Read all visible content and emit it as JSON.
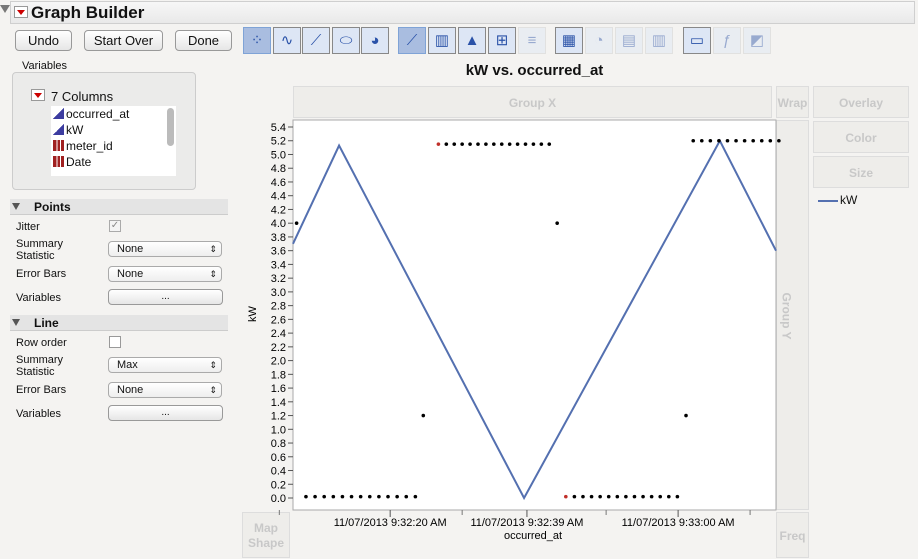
{
  "title": "Graph Builder",
  "buttons": {
    "undo": "Undo",
    "start_over": "Start Over",
    "done": "Done"
  },
  "variables": {
    "label": "Variables",
    "columns_label": "7 Columns",
    "columns": [
      {
        "name": "occurred_at",
        "type": "continuous"
      },
      {
        "name": "kW",
        "type": "continuous"
      },
      {
        "name": "meter_id",
        "type": "nominal"
      },
      {
        "name": "Date",
        "type": "nominal"
      }
    ]
  },
  "points": {
    "header": "Points",
    "jitter": "Jitter",
    "jitter_checked": true,
    "summary_label": "Summary Statistic",
    "summary_l1": "Summary",
    "summary_l2": "Statistic",
    "summary_value": "None",
    "error_bars_label": "Error Bars",
    "error_bars_value": "None",
    "variables_label": "Variables",
    "variables_button": "..."
  },
  "line": {
    "header": "Line",
    "row_order": "Row order",
    "row_order_checked": false,
    "summary_l1": "Summary",
    "summary_l2": "Statistic",
    "summary_value": "Max",
    "error_bars_label": "Error Bars",
    "error_bars_value": "None",
    "variables_label": "Variables",
    "variables_button": "..."
  },
  "zones": {
    "group_x": "Group X",
    "wrap": "Wrap",
    "overlay": "Overlay",
    "color": "Color",
    "size": "Size",
    "group_y": "Group Y",
    "map_shape_1": "Map",
    "map_shape_2": "Shape",
    "freq": "Freq"
  },
  "legend": {
    "label": "kW",
    "color": "#5470b0"
  },
  "chart_data": {
    "type": "line",
    "title": "kW vs. occurred_at",
    "xlabel": "occurred_at",
    "ylabel": "kW",
    "ylim": [
      0,
      5.4
    ],
    "yticks": [
      "0.0",
      "0.2",
      "0.4",
      "0.6",
      "0.8",
      "1.0",
      "1.2",
      "1.4",
      "1.6",
      "1.8",
      "2.0",
      "2.2",
      "2.4",
      "2.6",
      "2.8",
      "3.0",
      "3.2",
      "3.4",
      "3.6",
      "3.8",
      "4.0",
      "4.2",
      "4.4",
      "4.6",
      "4.8",
      "5.0",
      "5.2",
      "5.4"
    ],
    "x_unit": "seconds after 11/07/2013 9:32:00 AM",
    "xlim": [
      6.5,
      73.6
    ],
    "xticks": [
      {
        "value": 20,
        "label": "11/07/2013 9:32:20 AM"
      },
      {
        "value": 39,
        "label": "11/07/2013 9:32:39 AM"
      },
      {
        "value": 60,
        "label": "11/07/2013 9:33:00 AM"
      }
    ],
    "minor_xticks": [
      4.6,
      30,
      50,
      70
    ],
    "line_series": {
      "name": "kW (Max)",
      "color": "#5470b0",
      "x": [
        6.5,
        12.9,
        38.6,
        65.8,
        73.6
      ],
      "y": [
        3.7,
        5.13,
        0,
        5.2,
        3.6
      ]
    },
    "point_series": {
      "color": "#000000",
      "highlight_color": "#c0302a",
      "points": [
        {
          "x": 7,
          "y": 4.0
        },
        {
          "row_from": 8.3,
          "row_to": 23.5,
          "count": 13,
          "y": 0.02
        },
        {
          "x": 24.6,
          "y": 1.2
        },
        {
          "row_from": 26.7,
          "row_to": 42.1,
          "count": 15,
          "y": 5.15,
          "first_highlight": true
        },
        {
          "x": 43.2,
          "y": 4.0
        },
        {
          "row_from": 44.4,
          "row_to": 59.9,
          "count": 14,
          "y": 0.02,
          "first_highlight": true
        },
        {
          "x": 61.1,
          "y": 1.2
        },
        {
          "row_from": 62.1,
          "row_to": 74,
          "count": 11,
          "y": 5.2
        }
      ]
    }
  }
}
